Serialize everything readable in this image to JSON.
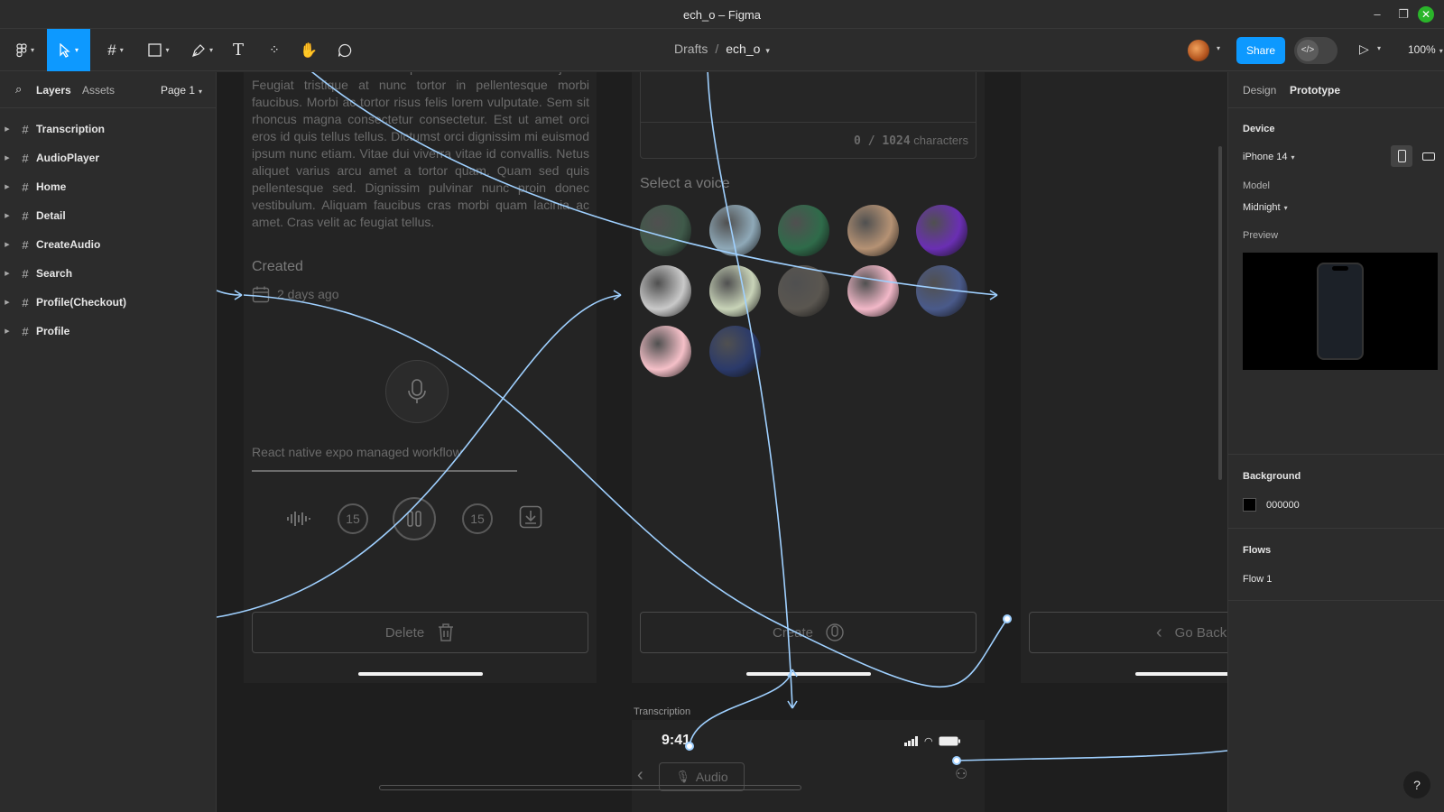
{
  "window": {
    "title": "ech_o – Figma"
  },
  "toolbar": {
    "breadcrumb_root": "Drafts",
    "breadcrumb_sep": "/",
    "file_name": "ech_o",
    "share_label": "Share",
    "zoom": "100%"
  },
  "left_panel": {
    "tab_layers": "Layers",
    "tab_assets": "Assets",
    "page": "Page 1",
    "layers": [
      "Transcription",
      "AudioPlayer",
      "Home",
      "Detail",
      "CreateAudio",
      "Search",
      "Profile(Checkout)",
      "Profile"
    ]
  },
  "canvas": {
    "detail_frame": {
      "body_text": "elementum. Odio mauris phasellus at elit lectus justo. Feugiat tristique at nunc tortor in pellentesque morbi faucibus. Morbi ac tortor risus felis lorem vulputate. Sem sit rhoncus magna consectetur consectetur. Est ut amet orci eros id quis tellus tellus. Dictumst orci dignissim mi euismod ipsum nunc etiam. Vitae dui viverra vitae id convallis. Netus aliquet varius arcu amet a tortor quam. Quam sed quis pellentesque sed. Dignissim pulvinar nunc proin donec vestibulum. Aliquam faucibus cras morbi quam lacinia ac amet. Cras velit ac feugiat tellus.",
      "created_label": "Created",
      "created_value": "2 days ago",
      "track_title": "React native expo managed workflow",
      "skip_back": "15",
      "skip_forward": "15",
      "delete_label": "Delete"
    },
    "create_frame": {
      "char_count": "0 / 1024",
      "char_unit": "characters",
      "voice_heading": "Select a voice",
      "create_label": "Create",
      "voice_colors": [
        "#3f5a4a",
        "#8fa9b8",
        "#2f6b4a",
        "#b59274",
        "#6a2fb3",
        "#c9c9c9",
        "#c8d3b8",
        "#5a5650",
        "#f2b8c8",
        "#4a5a8a",
        "#f5c0c8",
        "#2b3a6a"
      ]
    },
    "search_frame": {
      "goback_label": "Go Back"
    },
    "transcription_frame": {
      "label": "Transcription",
      "time": "9:41",
      "audio_label": "Audio"
    },
    "link_color": "#9fd0ff"
  },
  "right_panel": {
    "tab_design": "Design",
    "tab_prototype": "Prototype",
    "device_heading": "Device",
    "device_value": "iPhone 14",
    "model_label": "Model",
    "model_value": "Midnight",
    "preview_label": "Preview",
    "background_heading": "Background",
    "background_value": "000000",
    "flows_heading": "Flows",
    "flow_item": "Flow 1"
  },
  "help_label": "?"
}
